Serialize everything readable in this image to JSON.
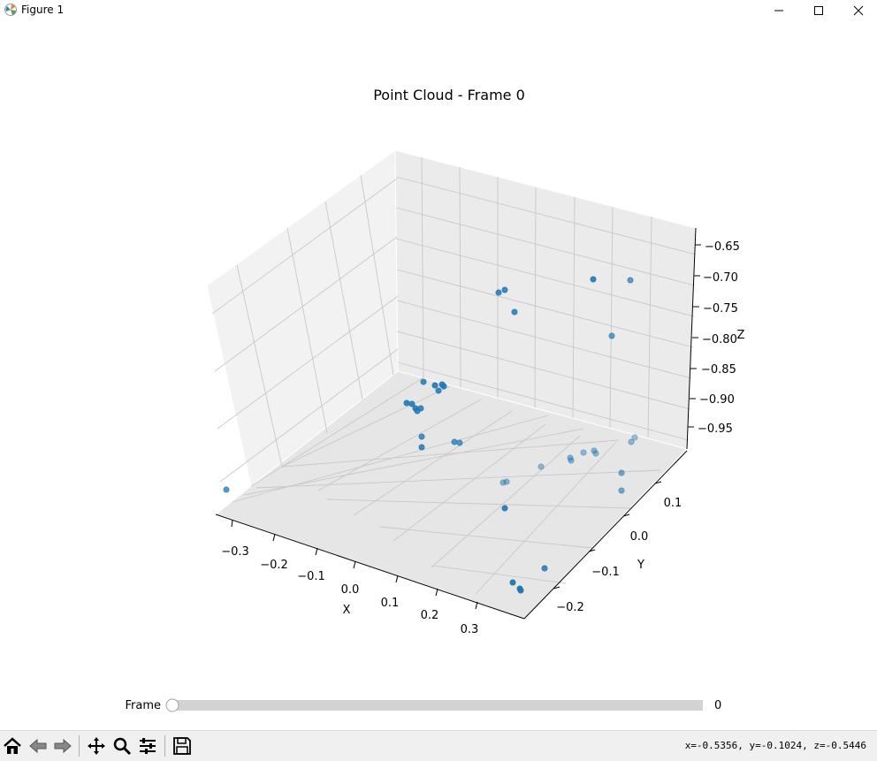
{
  "window": {
    "title": "Figure 1"
  },
  "figure": {
    "title": "Point Cloud - Frame 0"
  },
  "axes": {
    "x_label": "X",
    "y_label": "Y",
    "z_label": "Z",
    "x_ticks": [
      "−0.3",
      "−0.2",
      "−0.1",
      "0.0",
      "0.1",
      "0.2",
      "0.3"
    ],
    "y_ticks": [
      "0.1",
      "0.0",
      "−0.1",
      "−0.2"
    ],
    "z_ticks": [
      "−0.65",
      "−0.70",
      "−0.75",
      "−0.80",
      "−0.85",
      "−0.90",
      "−0.95"
    ]
  },
  "slider": {
    "label": "Frame",
    "value": "0",
    "fraction": 0
  },
  "toolbar": {
    "tools": [
      "home-icon",
      "back-arrow-icon",
      "forward-arrow-icon",
      "pan-icon",
      "zoom-icon",
      "subplots-config-icon",
      "save-icon"
    ],
    "coordinates": "x=-0.5356, y=-0.1024, z=-0.5446"
  },
  "colors": {
    "point": "#1f77b4",
    "pane": "#f2f2f2",
    "slider_track": "#d3d3d3"
  }
}
